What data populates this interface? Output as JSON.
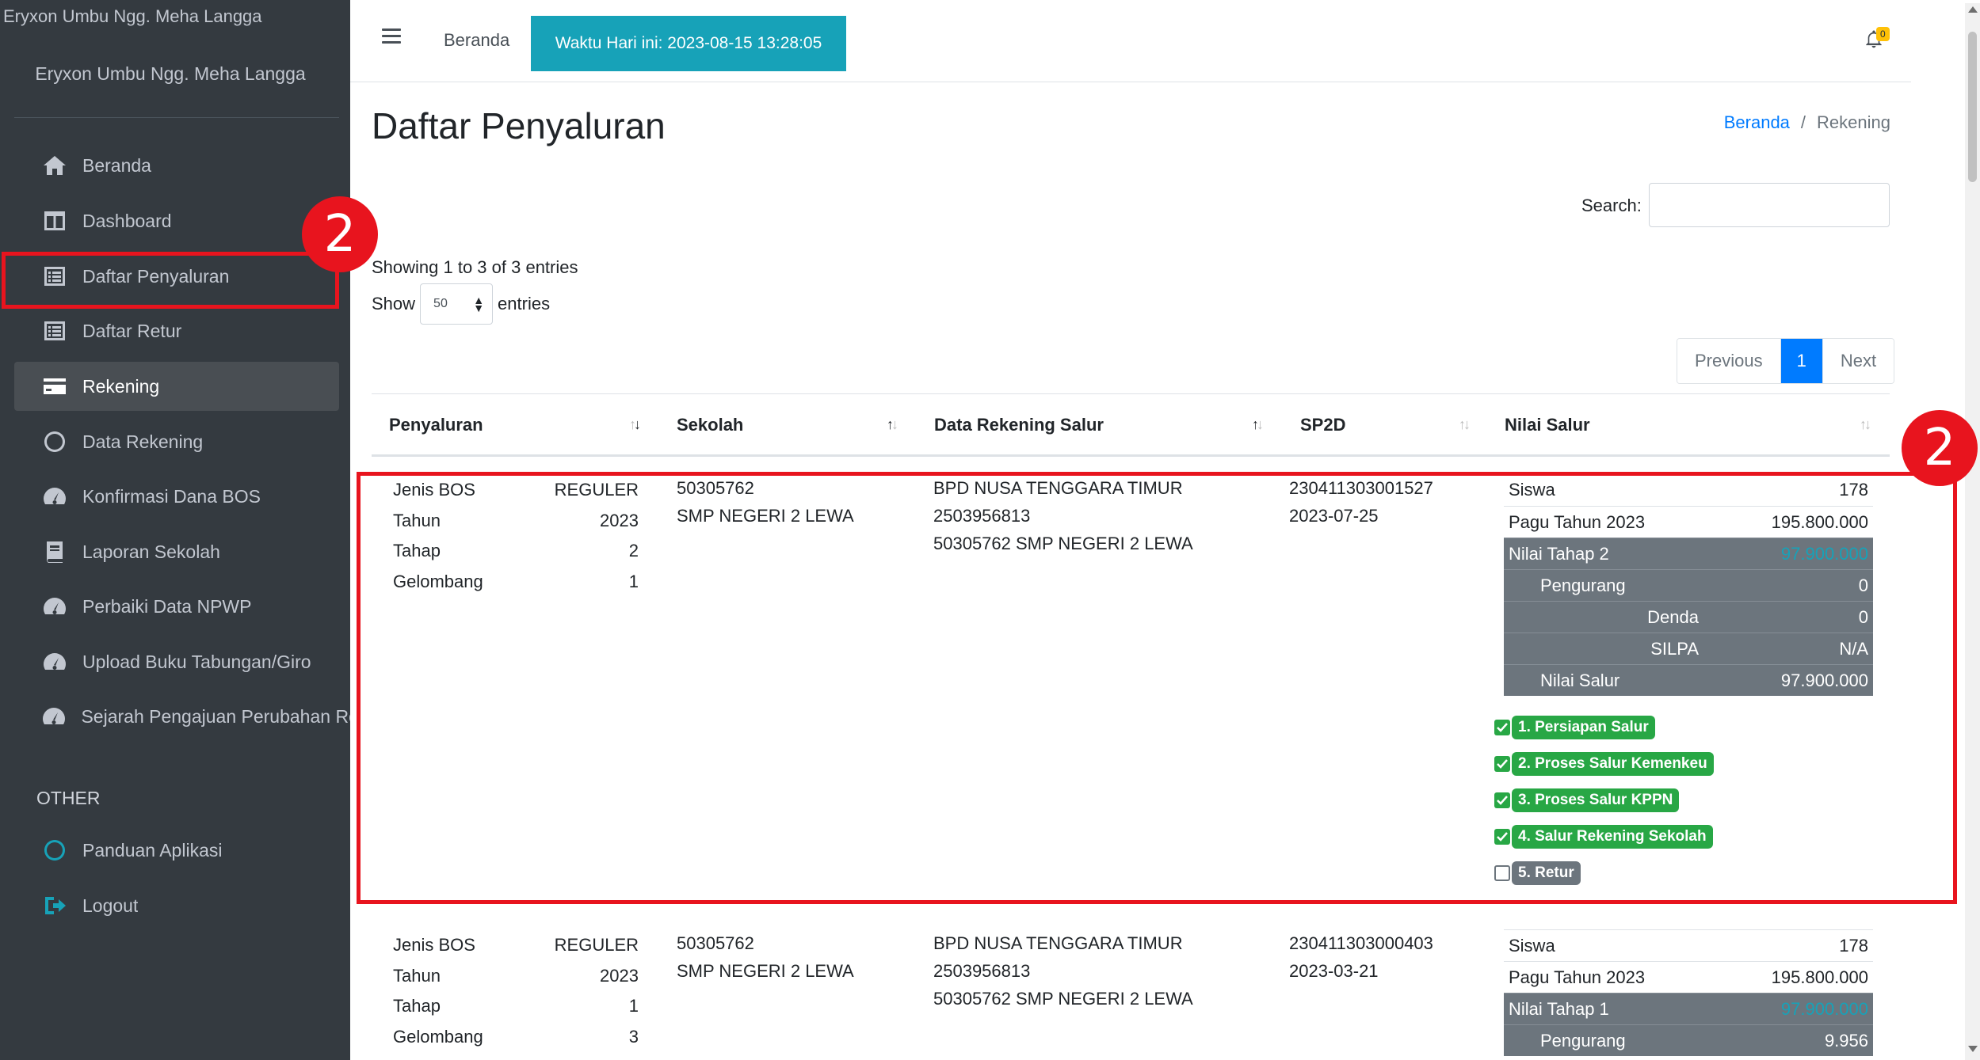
{
  "sidebar": {
    "top_user": "Eryxon Umbu Ngg. Meha Langga",
    "brand": "Eryxon Umbu Ngg. Meha Langga",
    "items": [
      {
        "label": "Beranda",
        "icon": "home-icon"
      },
      {
        "label": "Dashboard",
        "icon": "columns-icon"
      },
      {
        "label": "Daftar Penyaluran",
        "icon": "list-icon"
      },
      {
        "label": "Daftar Retur",
        "icon": "list-icon"
      },
      {
        "label": "Rekening",
        "icon": "credit-card-icon"
      },
      {
        "label": "Data Rekening",
        "icon": "circle-icon"
      },
      {
        "label": "Konfirmasi Dana BOS",
        "icon": "tachometer-icon"
      },
      {
        "label": "Laporan Sekolah",
        "icon": "book-icon"
      },
      {
        "label": "Perbaiki Data NPWP",
        "icon": "tachometer-icon"
      },
      {
        "label": "Upload Buku Tabungan/Giro",
        "icon": "tachometer-icon"
      },
      {
        "label": "Sejarah Pengajuan Perubahan Rel",
        "icon": "tachometer-icon"
      }
    ],
    "section_other": "OTHER",
    "other_items": [
      {
        "label": "Panduan Aplikasi",
        "icon": "circle-icon"
      },
      {
        "label": "Logout",
        "icon": "sign-out-icon"
      }
    ]
  },
  "annotations": {
    "badge1": "2",
    "badge2": "2"
  },
  "topbar": {
    "home": "Beranda",
    "time": "Waktu Hari ini: 2023-08-15 13:28:05",
    "notif_count": "0"
  },
  "page": {
    "title": "Daftar Penyaluran",
    "breadcrumb_home": "Beranda",
    "breadcrumb_sep": "/",
    "breadcrumb_current": "Rekening"
  },
  "datatable": {
    "search_label": "Search:",
    "search_value": "",
    "info": "Showing 1 to 3 of 3 entries",
    "show_label": "Show",
    "show_value": "50",
    "entries_label": "entries",
    "prev": "Previous",
    "page": "1",
    "next": "Next"
  },
  "columns": [
    "Penyaluran",
    "Sekolah",
    "Data Rekening Salur",
    "SP2D",
    "Nilai Salur"
  ],
  "rows": [
    {
      "penyaluran": {
        "jenis_label": "Jenis BOS",
        "jenis_value": "REGULER",
        "tahun_label": "Tahun",
        "tahun_value": "2023",
        "tahap_label": "Tahap",
        "tahap_value": "2",
        "gelombang_label": "Gelombang",
        "gelombang_value": "1"
      },
      "sekolah": {
        "npsn": "50305762",
        "nama": "SMP NEGERI 2 LEWA"
      },
      "rekening": {
        "bank": "BPD NUSA TENGGARA TIMUR",
        "no": "2503956813",
        "nama": "50305762 SMP NEGERI 2 LEWA"
      },
      "sp2d": {
        "no": "230411303001527",
        "tanggal": "2023-07-25"
      },
      "nilai": {
        "siswa_label": "Siswa",
        "siswa": "178",
        "pagu_label": "Pagu Tahun 2023",
        "pagu": "195.800.000",
        "tahap_label": "Nilai Tahap 2",
        "tahap": "97.900.000",
        "pengurang_label": "Pengurang",
        "pengurang": "0",
        "denda_label": "Denda",
        "denda": "0",
        "silpa_label": "SILPA",
        "silpa": "N/A",
        "salur_label": "Nilai Salur",
        "salur": "97.900.000"
      },
      "steps": [
        {
          "label": "1. Persiapan Salur",
          "checked": true
        },
        {
          "label": "2. Proses Salur Kemenkeu",
          "checked": true
        },
        {
          "label": "3. Proses Salur KPPN",
          "checked": true
        },
        {
          "label": "4. Salur Rekening Sekolah",
          "checked": true
        },
        {
          "label": "5. Retur",
          "checked": false
        }
      ]
    },
    {
      "penyaluran": {
        "jenis_label": "Jenis BOS",
        "jenis_value": "REGULER",
        "tahun_label": "Tahun",
        "tahun_value": "2023",
        "tahap_label": "Tahap",
        "tahap_value": "1",
        "gelombang_label": "Gelombang",
        "gelombang_value": "3"
      },
      "sekolah": {
        "npsn": "50305762",
        "nama": "SMP NEGERI 2 LEWA"
      },
      "rekening": {
        "bank": "BPD NUSA TENGGARA TIMUR",
        "no": "2503956813",
        "nama": "50305762 SMP NEGERI 2 LEWA"
      },
      "sp2d": {
        "no": "230411303000403",
        "tanggal": "2023-03-21"
      },
      "nilai": {
        "siswa_label": "Siswa",
        "siswa": "178",
        "pagu_label": "Pagu Tahun 2023",
        "pagu": "195.800.000",
        "tahap_label": "Nilai Tahap 1",
        "tahap": "97.900.000",
        "pengurang_label": "Pengurang",
        "pengurang": "9.956"
      }
    }
  ],
  "colors": {
    "sidebar": "#343a40",
    "accent": "#17a2b8",
    "primary": "#007bff",
    "success": "#28a745",
    "annotation": "#e8141e"
  }
}
